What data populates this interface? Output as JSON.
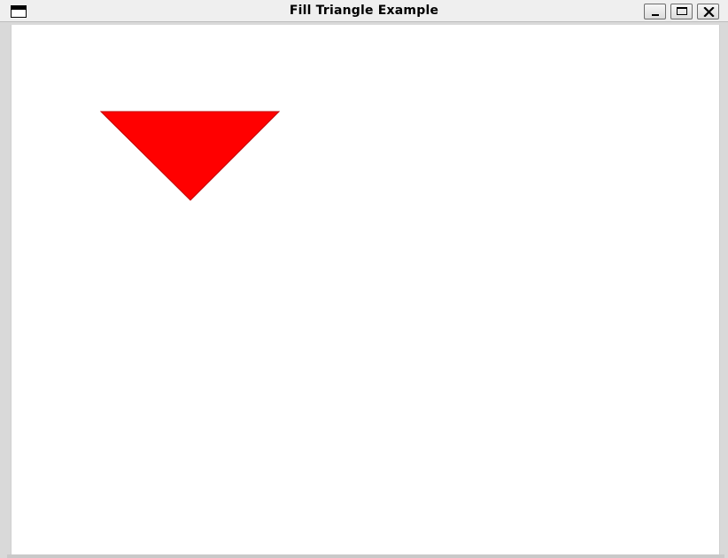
{
  "window": {
    "title": "Fill Triangle Example",
    "controls": {
      "minimize_icon": "minimize-icon",
      "maximize_icon": "maximize-icon",
      "close_icon": "close-icon"
    }
  },
  "canvas": {
    "background_color": "#ffffff",
    "triangle": {
      "fill_color": "#ff0000",
      "stroke_color": "#c00000"
    }
  }
}
